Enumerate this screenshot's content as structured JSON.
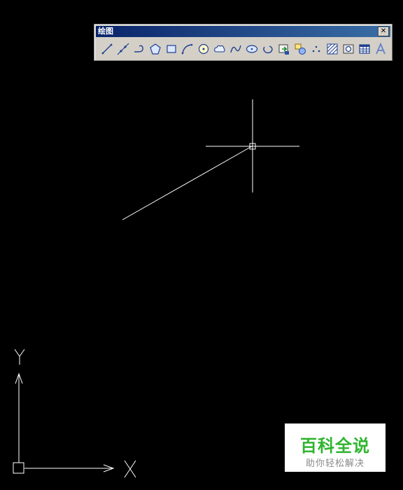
{
  "toolbar": {
    "title": "绘图",
    "close_label": "✕",
    "tools": [
      {
        "name": "line-icon"
      },
      {
        "name": "construction-line-icon"
      },
      {
        "name": "polyline-icon"
      },
      {
        "name": "polygon-icon"
      },
      {
        "name": "rectangle-icon"
      },
      {
        "name": "arc-icon"
      },
      {
        "name": "circle-icon"
      },
      {
        "name": "revision-cloud-icon"
      },
      {
        "name": "spline-icon"
      },
      {
        "name": "ellipse-icon"
      },
      {
        "name": "ellipse-arc-icon"
      },
      {
        "name": "insert-block-icon"
      },
      {
        "name": "make-block-icon"
      },
      {
        "name": "point-icon"
      },
      {
        "name": "hatch-icon"
      },
      {
        "name": "region-icon"
      },
      {
        "name": "table-icon"
      },
      {
        "name": "multiline-text-icon"
      }
    ]
  },
  "ucs": {
    "x_label": "X",
    "y_label": "Y"
  },
  "watermark": {
    "main": "百科全说",
    "sub": "助你轻松解决"
  },
  "colors": {
    "background": "#000000",
    "drawing": "#ffffff",
    "toolbar_bg": "#d4d0c8",
    "watermark_green": "#2fb52f"
  }
}
